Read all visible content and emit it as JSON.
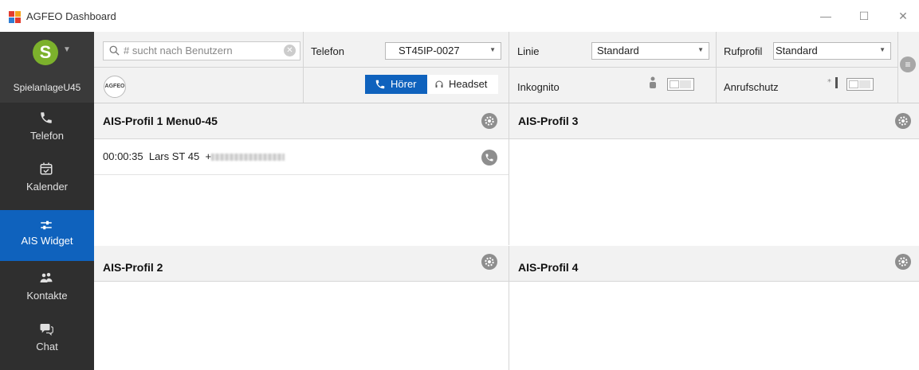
{
  "window": {
    "title": "AGFEO Dashboard",
    "minimize_icon": "—",
    "maximize_icon": "☐",
    "close_icon": "✕"
  },
  "user": {
    "avatar_letter": "S",
    "name": "SpielanlageU45",
    "avatar_color": "#7cb12c"
  },
  "nav": [
    {
      "label": "Telefon",
      "icon": "phone-icon"
    },
    {
      "label": "Kalender",
      "icon": "calendar-icon"
    },
    {
      "label": "AIS Widget",
      "icon": "sliders-icon",
      "active": true
    },
    {
      "label": "Kontakte",
      "icon": "contacts-icon"
    },
    {
      "label": "Chat",
      "icon": "chat-icon"
    }
  ],
  "toolbar": {
    "search_placeholder": "# sucht nach Benutzern",
    "telefon_label": "Telefon",
    "telefon_value": "ST45IP-0027",
    "linie_label": "Linie",
    "linie_value": "Standard",
    "rufprofil_label": "Rufprofil",
    "rufprofil_value": "Standard",
    "logo_text": "AGFEO",
    "hoerer_label": "Hörer",
    "headset_label": "Headset",
    "inkognito_label": "Inkognito",
    "anrufschutz_label": "Anrufschutz",
    "accent_color": "#0f62bd"
  },
  "panels": [
    {
      "title": "AIS-Profil 1 Menu0-45"
    },
    {
      "title": "AIS-Profil 3"
    },
    {
      "title": "AIS-Profil 2"
    },
    {
      "title": "AIS-Profil 4"
    }
  ],
  "call": {
    "duration": "00:00:35",
    "name": "Lars ST 45",
    "number_prefix": "+"
  }
}
